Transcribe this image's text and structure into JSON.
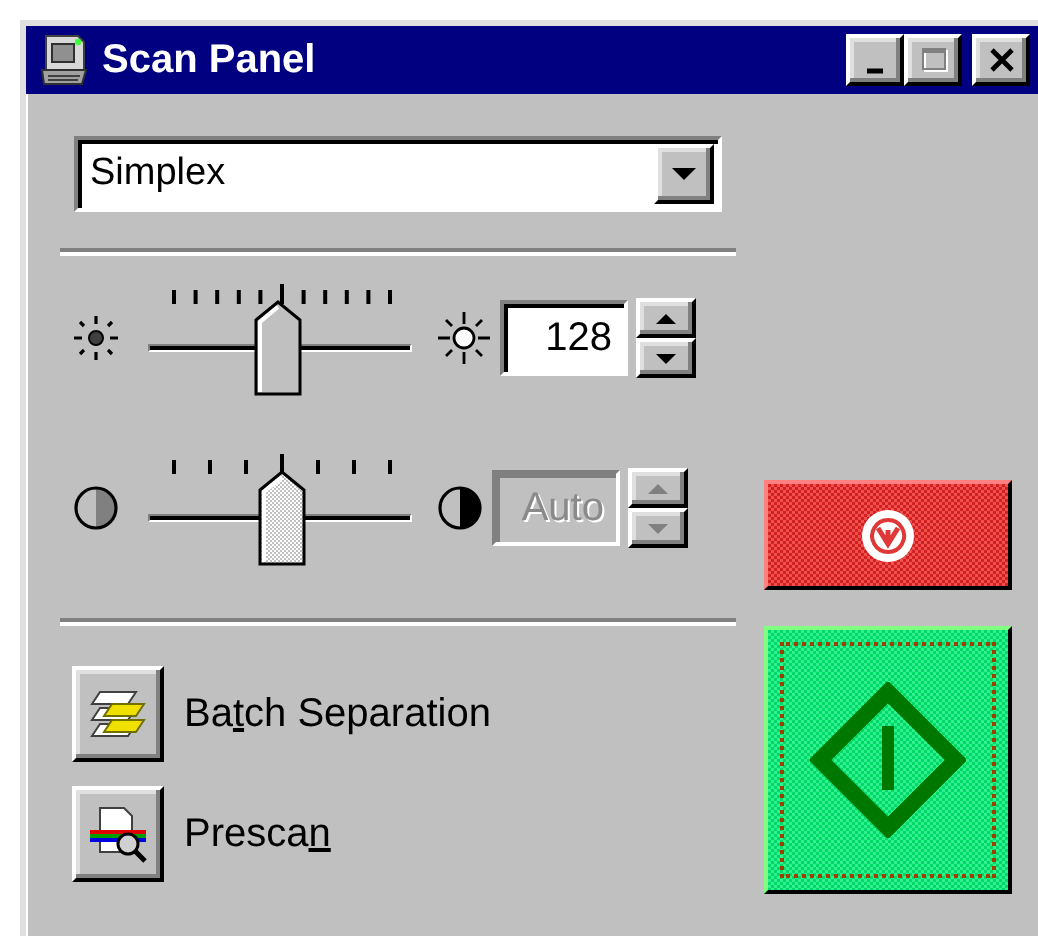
{
  "window": {
    "title": "Scan Panel",
    "controls": [
      {
        "kind": "minimize",
        "disabled": false
      },
      {
        "kind": "maximize",
        "disabled": true
      },
      {
        "kind": "close",
        "disabled": false
      }
    ]
  },
  "mode_dropdown": {
    "value": "Simplex"
  },
  "sliders": [
    {
      "kind": "brightness",
      "level": 0.49,
      "value": "128",
      "disabled": false
    },
    {
      "kind": "contrast",
      "level": 0.51,
      "value": "Auto",
      "disabled": true
    }
  ],
  "actions": [
    {
      "kind": "batch",
      "label_before": "Ba",
      "access_key": "t",
      "label_after": "ch Separation"
    },
    {
      "kind": "prescan",
      "label_before": "Presca",
      "access_key": "n"
    }
  ]
}
